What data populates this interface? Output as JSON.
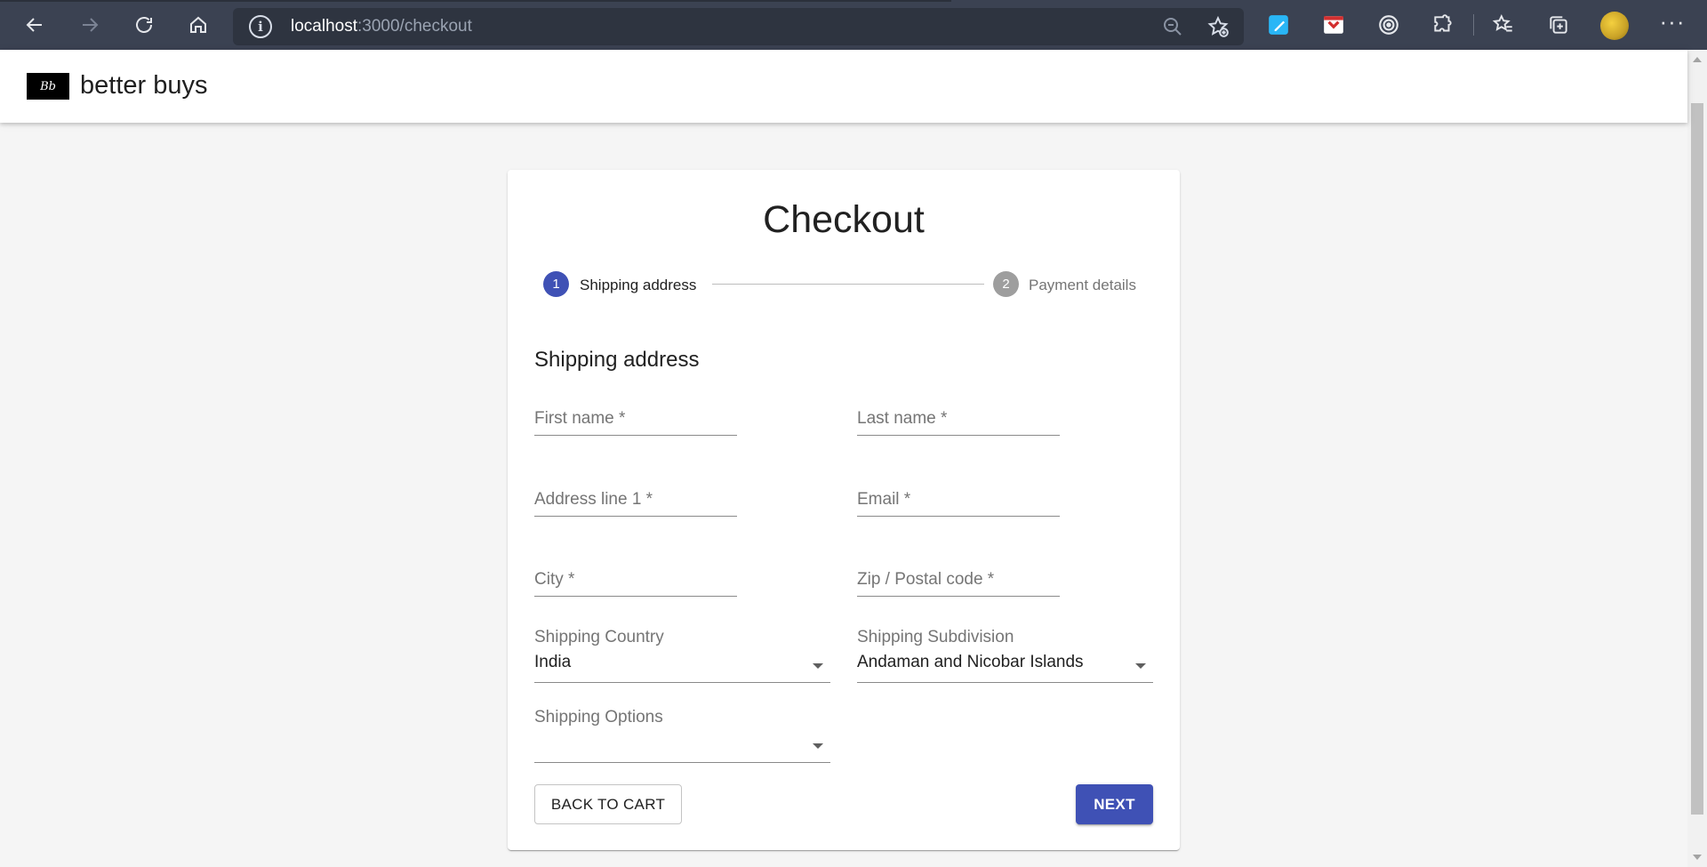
{
  "browser": {
    "url_host": "localhost",
    "url_path": ":3000/checkout"
  },
  "app": {
    "logo_text": "Bb",
    "brand": "better buys"
  },
  "checkout": {
    "title": "Checkout",
    "steps": [
      {
        "number": "1",
        "label": "Shipping address",
        "active": true
      },
      {
        "number": "2",
        "label": "Payment details",
        "active": false
      }
    ],
    "section_title": "Shipping address",
    "fields": {
      "first_name": "First name *",
      "last_name": "Last name *",
      "address_line1": "Address line 1 *",
      "email": "Email *",
      "city": "City *",
      "zip": "Zip / Postal code *"
    },
    "selects": {
      "country": {
        "label": "Shipping Country",
        "value": "India"
      },
      "subdivision": {
        "label": "Shipping Subdivision",
        "value": "Andaman and Nicobar Islands"
      },
      "options": {
        "label": "Shipping Options",
        "value": ""
      }
    },
    "buttons": {
      "back": "BACK TO CART",
      "next": "NEXT"
    }
  },
  "colors": {
    "primary": "#3f51b5",
    "browser_chrome": "#3b4252"
  }
}
